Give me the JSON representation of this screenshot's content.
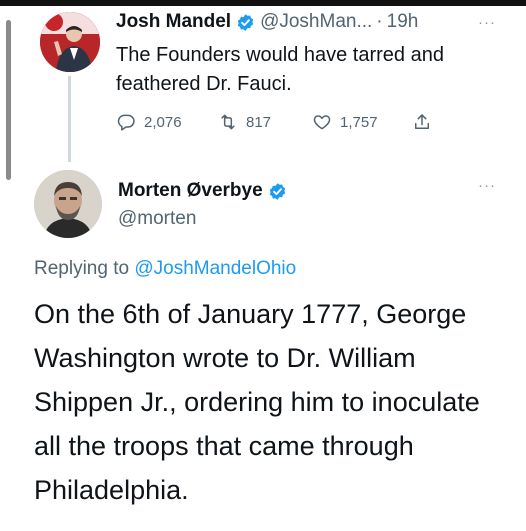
{
  "parent_tweet": {
    "display_name": "Josh Mandel",
    "handle": "@JoshMan...",
    "separator": "·",
    "time": "19h",
    "more": "···",
    "text": "The Founders would have tarred and feathered Dr. Fauci.",
    "actions": {
      "reply_count": "2,076",
      "retweet_count": "817",
      "like_count": "1,757"
    }
  },
  "reply_tweet": {
    "display_name": "Morten Øverbye",
    "handle": "@morten",
    "more": "···",
    "replying_prefix": "Replying to",
    "replying_to": "@JoshMandelOhio",
    "text": "On the 6th of January 1777, George Washington wrote to Dr. William Shippen Jr., ordering him to inoculate all the troops that came through Philadelphia."
  },
  "colors": {
    "verified": "#1d9bf0",
    "link": "#1d9bf0",
    "secondary_text": "#536471",
    "thread_line": "#cfd9de"
  },
  "icons": {
    "verified": "verified-badge-icon",
    "reply": "reply-icon",
    "retweet": "retweet-icon",
    "like": "heart-icon",
    "share": "share-icon",
    "more": "more-options-icon"
  }
}
